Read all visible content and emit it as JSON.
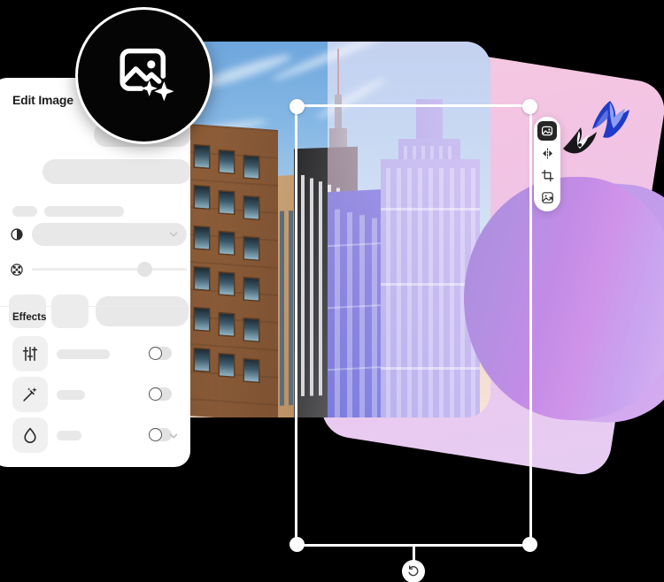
{
  "panel": {
    "title": "Edit Image",
    "effects_section_title": "Effects",
    "effects": [
      {
        "icon": "sliders-icon",
        "label": "",
        "toggle_state": "off"
      },
      {
        "icon": "magic-wand-icon",
        "label": "",
        "toggle_state": "off"
      },
      {
        "icon": "droplet-icon",
        "label": "",
        "toggle_state": "off"
      }
    ],
    "controls": [
      {
        "icon": "contrast-icon",
        "type": "dropdown"
      },
      {
        "icon": "checkerboard-icon",
        "type": "slider",
        "value_percent": 82
      }
    ]
  },
  "badge": {
    "icon": "image-sparkle-icon"
  },
  "toolbar": {
    "items": [
      {
        "icon": "image-icon",
        "active": true
      },
      {
        "icon": "flip-horizontal-icon",
        "active": false
      },
      {
        "icon": "crop-icon",
        "active": false
      },
      {
        "icon": "image-export-icon",
        "active": false
      }
    ]
  },
  "canvas": {
    "selection": {
      "handles": [
        "top-left",
        "top-right",
        "bottom-left",
        "bottom-right"
      ],
      "rotate_icon": "rotate-ccw-icon"
    },
    "decorations": [
      {
        "name": "bird-black-white"
      },
      {
        "name": "bird-blue"
      }
    ]
  },
  "colors": {
    "badge_bg": "#050505",
    "panel_bg": "#ffffff",
    "skeleton": "#e8e8e8",
    "pink_shape": "#f2c3e3",
    "purple_blob": "#b48fe2",
    "selection_stroke": "#ffffff",
    "accent_blue": "#3b46cf",
    "periwinkle": "#9a93e6",
    "background": "#000000"
  }
}
